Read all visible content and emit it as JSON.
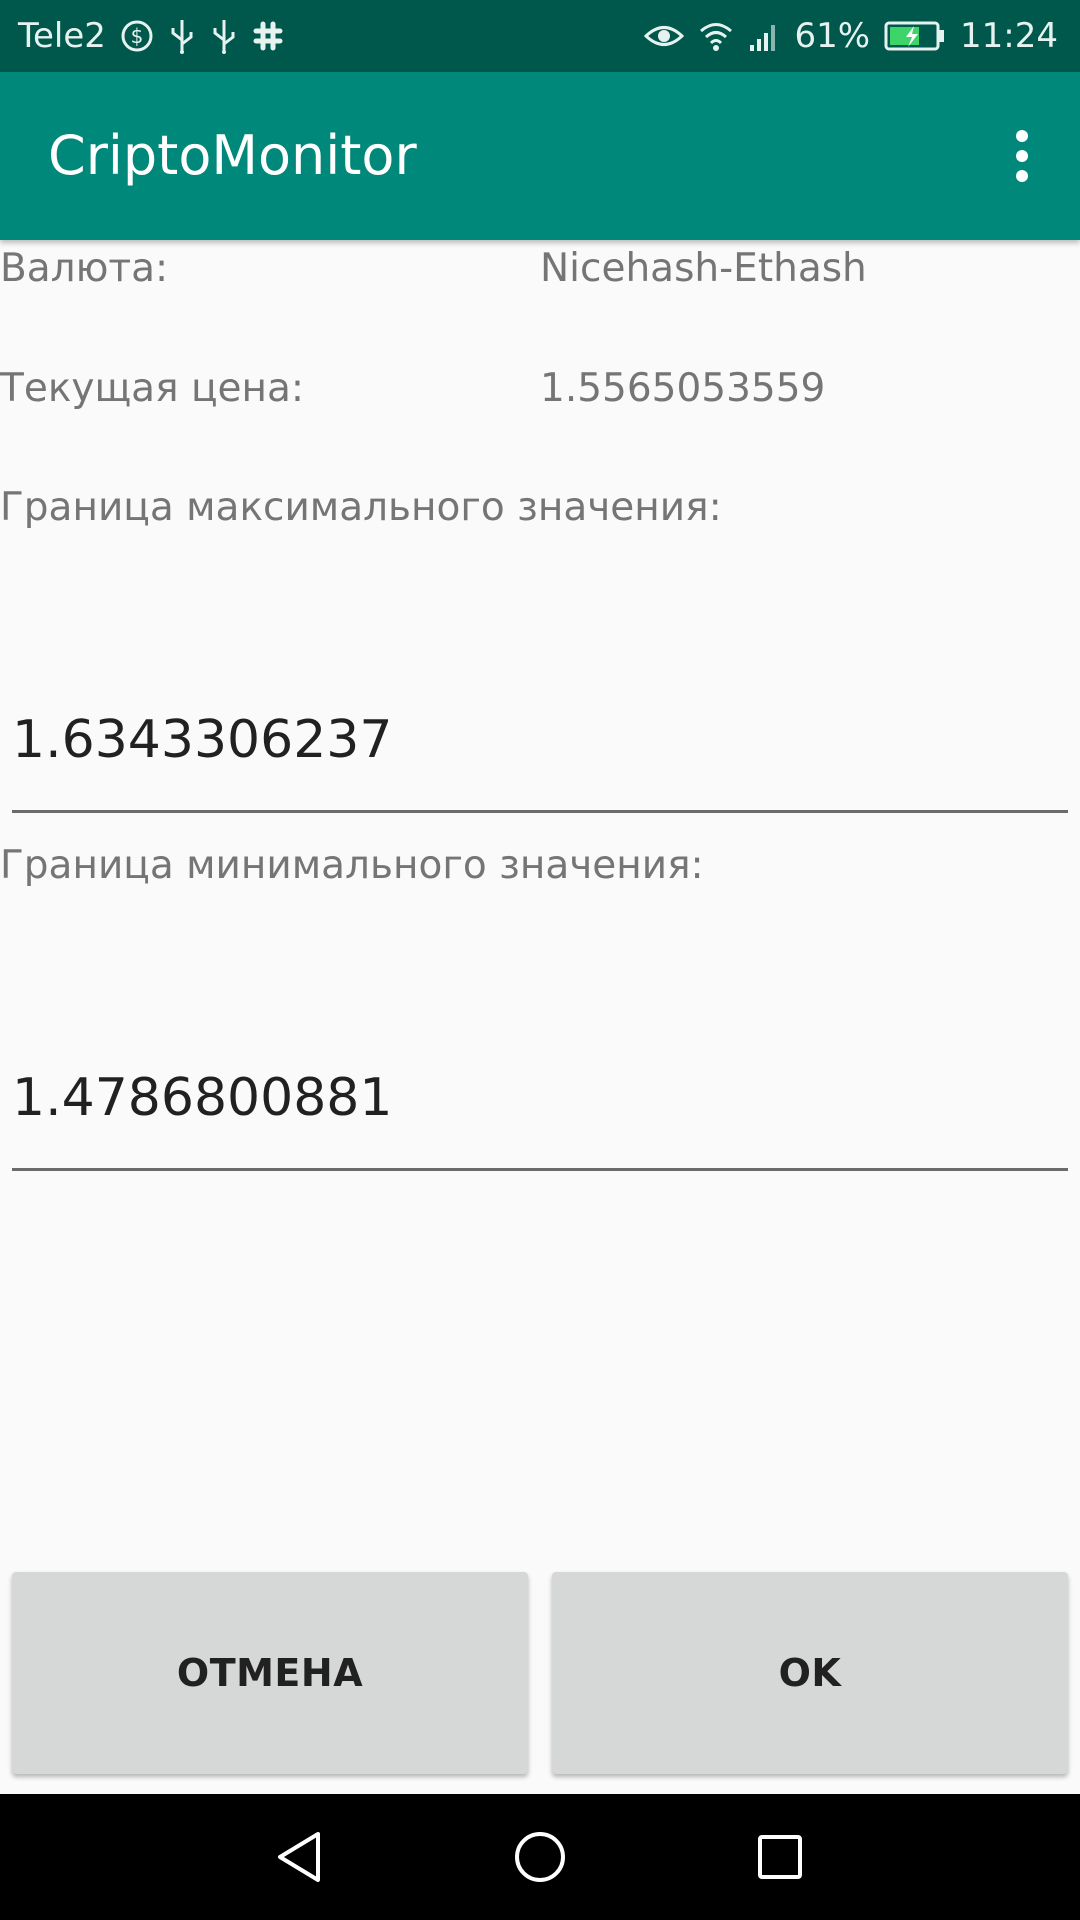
{
  "status_bar": {
    "carrier": "Tele2",
    "battery_percent": "61%",
    "time": "11:24",
    "icons_left": [
      "dollar-circle-icon",
      "usb-icon",
      "usb-icon",
      "slack-icon"
    ],
    "icons_right": [
      "eye-icon",
      "wifi-icon",
      "signal-icon",
      "battery-charging-icon"
    ]
  },
  "app_bar": {
    "title": "CriptoMonitor",
    "menu_icon": "more-vert-icon"
  },
  "form": {
    "currency_label": "Валюта:",
    "currency_value": "Nicehash-Ethash",
    "price_label": "Текущая цена:",
    "price_value": "1.5565053559",
    "max_label": "Граница максимального значения:",
    "max_value": "1.6343306237",
    "min_label": "Граница минимального значения:",
    "min_value": "1.4786800881"
  },
  "buttons": {
    "cancel": "ОТМЕНА",
    "ok": "OK"
  },
  "nav_bar": {
    "icons": [
      "back-icon",
      "home-icon",
      "recents-icon"
    ]
  },
  "colors": {
    "status_bar": "#00574b",
    "app_bar": "#00887a",
    "background": "#fafafa",
    "button": "#d6d7d7"
  }
}
